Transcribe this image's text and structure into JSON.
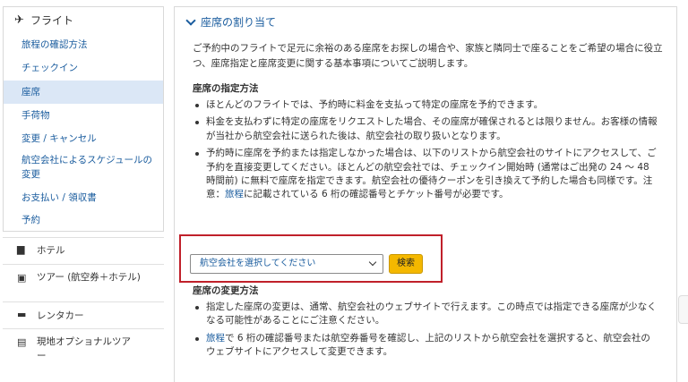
{
  "sidebar": {
    "flight": {
      "label": "フライト",
      "items": [
        {
          "label": "旅程の確認方法"
        },
        {
          "label": "チェックイン"
        },
        {
          "label": "座席"
        },
        {
          "label": "手荷物"
        },
        {
          "label": "変更 / キャンセル"
        },
        {
          "label": "航空会社によるスケジュールの変更"
        },
        {
          "label": "お支払い / 領収書"
        },
        {
          "label": "予約"
        }
      ]
    },
    "categories": [
      {
        "label": "ホテル",
        "icon": "bed-icon"
      },
      {
        "label": "ツアー (航空券＋ホテル)",
        "icon": "suitcase-icon"
      },
      {
        "label": "レンタカー",
        "icon": "car-icon"
      },
      {
        "label": "現地オプショナルツアー",
        "icon": "ticket-icon"
      }
    ]
  },
  "main": {
    "section_title": "座席の割り当て",
    "intro": "ご予約中のフライトで足元に余裕のある座席をお探しの場合や、家族と隣同士で座ることをご希望の場合に役立つ、座席指定と座席変更に関する基本事項についてご説明します。",
    "assign": {
      "heading": "座席の指定方法",
      "bullets": [
        "ほとんどのフライトでは、予約時に料金を支払って特定の座席を予約できます。",
        "料金を支払わずに特定の座席をリクエストした場合、その座席が確保されるとは限りません。お客様の情報が当社から航空会社に送られた後は、航空会社の取り扱いとなります。"
      ],
      "bullet3_before": "予約時に座席を予約または指定しなかった場合は、以下のリストから航空会社のサイトにアクセスして、ご予約を直接変更してください。ほとんどの航空会社では、チェックイン開始時 (通常はご出発の 24 ～ 48 時間前) に無料で座席を指定できます。航空会社の優待クーポンを引き換えて予約した場合も同様です。注意：",
      "bullet3_link": "旅程",
      "bullet3_after": "に記載されている 6 桁の確認番号とチケット番号が必要です。"
    },
    "airline_select": {
      "selected": "航空会社を選択してください",
      "search_label": "検索"
    },
    "change": {
      "heading": "座席の変更方法",
      "bullet1": "指定した座席の変更は、通常、航空会社のウェブサイトで行えます。この時点では指定できる座席が少なくなる可能性があることにご注意ください。",
      "bullet2_link": "旅程",
      "bullet2_after": "で 6 桁の確認番号または航空券番号を確認し、上記のリストから航空会社を選択すると、航空会社のウェブサイトにアクセスして変更できます。"
    }
  },
  "colors": {
    "link": "#1a5c9e",
    "active_bg": "#dbe7f6",
    "highlight": "#c0202a",
    "button": "#f4b800"
  }
}
